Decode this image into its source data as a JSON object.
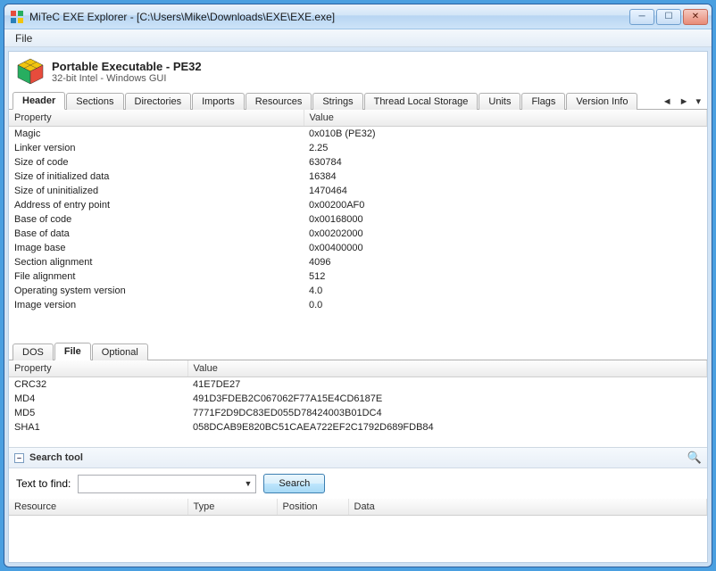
{
  "window": {
    "title": "MiTeC EXE Explorer - [C:\\Users\\Mike\\Downloads\\EXE\\EXE.exe]"
  },
  "menu": {
    "file": "File"
  },
  "file_info": {
    "title": "Portable Executable - PE32",
    "subtitle": "32-bit Intel - Windows GUI"
  },
  "tabs": [
    "Header",
    "Sections",
    "Directories",
    "Imports",
    "Resources",
    "Strings",
    "Thread Local Storage",
    "Units",
    "Flags",
    "Version Info"
  ],
  "active_tab": 0,
  "main_grid": {
    "columns": [
      "Property",
      "Value"
    ],
    "rows": [
      [
        "Magic",
        "0x010B (PE32)"
      ],
      [
        "Linker version",
        "2.25"
      ],
      [
        "Size of code",
        "630784"
      ],
      [
        "Size of initialized data",
        "16384"
      ],
      [
        "Size of uninitialized",
        "1470464"
      ],
      [
        "Address of entry point",
        "0x00200AF0"
      ],
      [
        "Base of code",
        "0x00168000"
      ],
      [
        "Base of data",
        "0x00202000"
      ],
      [
        "Image base",
        "0x00400000"
      ],
      [
        "Section alignment",
        "4096"
      ],
      [
        "File alignment",
        "512"
      ],
      [
        "Operating system version",
        "4.0"
      ],
      [
        "Image version",
        "0.0"
      ]
    ]
  },
  "sub_tabs": [
    "DOS",
    "File",
    "Optional"
  ],
  "active_sub_tab": 1,
  "lower_grid": {
    "columns": [
      "Property",
      "Value"
    ],
    "rows": [
      [
        "CRC32",
        "41E7DE27"
      ],
      [
        "MD4",
        "491D3FDEB2C067062F77A15E4CD6187E"
      ],
      [
        "MD5",
        "7771F2D9DC83ED055D78424003B01DC4"
      ],
      [
        "SHA1",
        "058DCAB9E820BC51CAEA722EF2C1792D689FDB84"
      ]
    ]
  },
  "search": {
    "panel_title": "Search tool",
    "label": "Text to find:",
    "value": "",
    "button": "Search"
  },
  "results_grid": {
    "columns": [
      "Resource",
      "Type",
      "Position",
      "Data"
    ]
  }
}
